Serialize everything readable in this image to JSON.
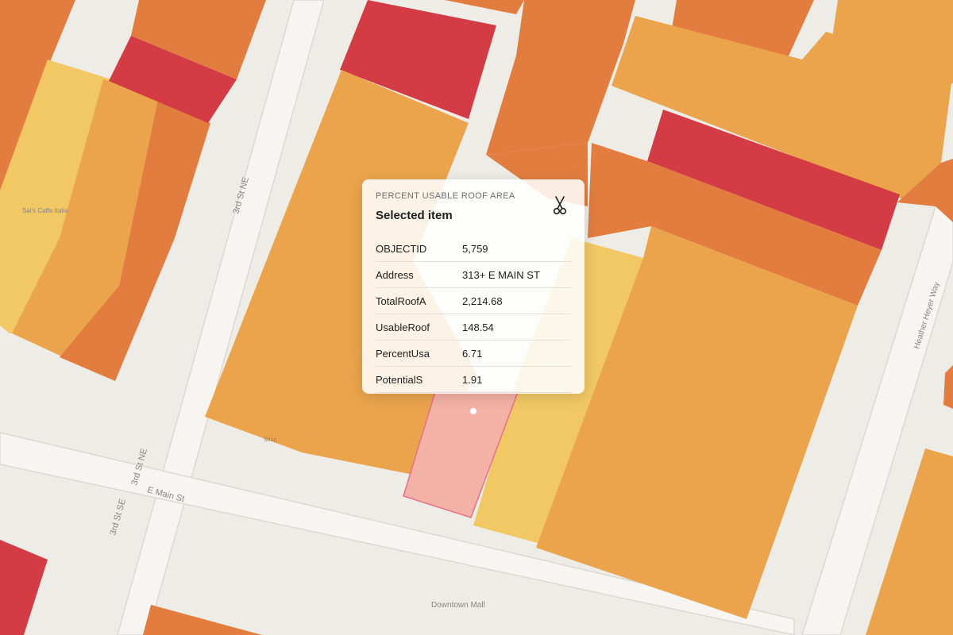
{
  "layer_title": "PERCENT USABLE ROOF AREA",
  "selected_title": "Selected item",
  "attributes": [
    {
      "key": "OBJECTID",
      "value": "5,759"
    },
    {
      "key": "Address",
      "value": "313+ E MAIN ST"
    },
    {
      "key": "TotalRoofA",
      "value": "2,214.68"
    },
    {
      "key": "UsableRoof",
      "value": "148.54"
    },
    {
      "key": "PercentUsa",
      "value": "6.71"
    },
    {
      "key": "PotentialS",
      "value": "1.91"
    }
  ],
  "tool_icon": "scissors-icon",
  "map_labels": {
    "street_3rd_ne_upper": "3rd St NE",
    "street_3rd_ne_lower": "3rd St NE",
    "street_3rd_se": "3rd St SE",
    "street_e_main": "E Main St",
    "street_heather_heyer": "Heather Heyer Way",
    "poi_downtown_mall": "Downtown Mall",
    "poi_sals_caffe": "Sal's Caffe Italia",
    "poi_shop": "Shop"
  },
  "colors": {
    "ground": "#eeece6",
    "road": "#f6f5f1",
    "roof_low": "#e27d3f",
    "roof_mid": "#eba44b",
    "roof_high": "#f1c864",
    "roof_very_low": "#d33c45",
    "selected_fill": "#f4b2a6",
    "selected_stroke": "#e86f8a"
  }
}
